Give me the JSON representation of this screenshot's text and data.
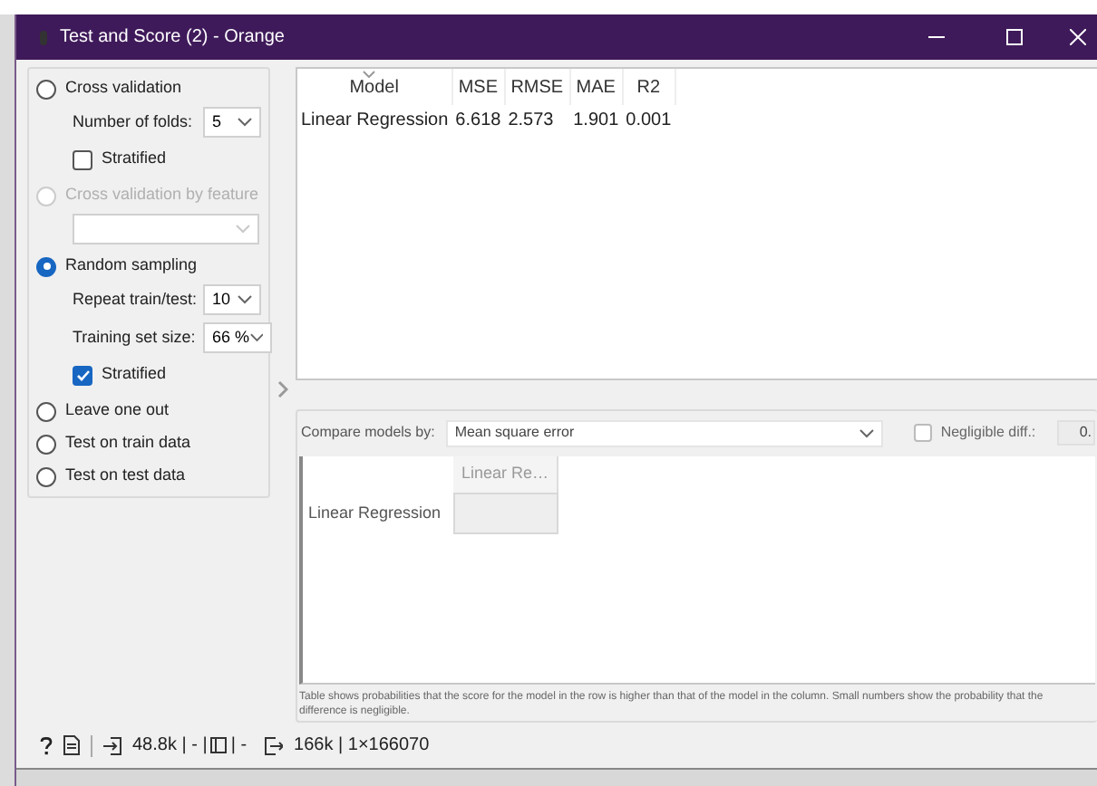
{
  "window": {
    "title": "Test and Score (2) - Orange"
  },
  "methods": [
    {
      "label": "Cross validation",
      "selected": false,
      "disabled": false,
      "settings": [
        {
          "kind": "dropdown",
          "label": "Number of folds:",
          "value": "5"
        },
        {
          "kind": "checkbox",
          "label": "Stratified",
          "checked": false
        }
      ]
    },
    {
      "label": "Cross validation by feature",
      "selected": false,
      "disabled": true,
      "settings": [
        {
          "kind": "dropdown"
        }
      ]
    },
    {
      "label": "Random sampling",
      "selected": true,
      "disabled": false,
      "settings": [
        {
          "kind": "dropdown",
          "label": "Repeat train/test:",
          "value": "10"
        },
        {
          "kind": "dropdown",
          "label": "Training set size:",
          "value": "66 %"
        },
        {
          "kind": "checkbox",
          "label": "Stratified",
          "checked": true
        }
      ]
    },
    {
      "label": "Leave one out",
      "selected": false,
      "disabled": false
    },
    {
      "label": "Test on train data",
      "selected": false,
      "disabled": false
    },
    {
      "label": "Test on test data",
      "selected": false,
      "disabled": false
    }
  ],
  "results": {
    "columns": [
      "Model",
      "MSE",
      "RMSE",
      "MAE",
      "R2"
    ],
    "rows": [
      [
        "Linear Regression",
        "6.618",
        "2.573",
        "1.901",
        "0.001"
      ]
    ]
  },
  "compare": {
    "label": "Compare models by:",
    "value": "Mean square error",
    "negligible": {
      "label": "Negligible diff.:",
      "checked": false,
      "value": "0."
    }
  },
  "comparison_table": {
    "columns": [
      "Linear Re…"
    ],
    "rows": [
      "Linear Regression"
    ]
  },
  "note": "Table shows probabilities that the score for the model in the row is higher than that of the model in the column. Small numbers show the probability that the difference is negligible.",
  "status_bar": {
    "input_before": "48.8k | - |",
    "input_after": "| -",
    "output": "166k | 1×166070"
  }
}
